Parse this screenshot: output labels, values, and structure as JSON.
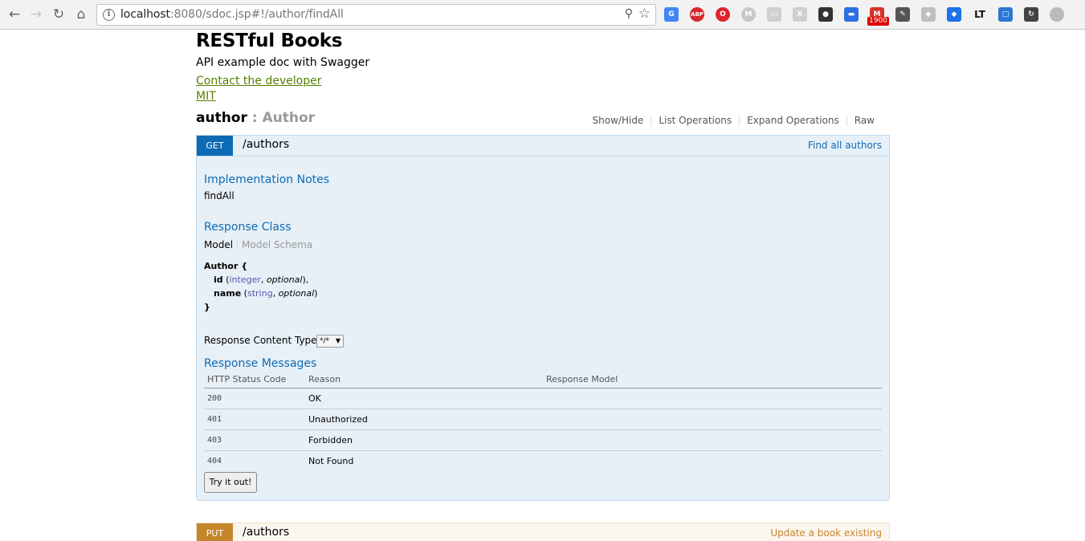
{
  "browser": {
    "url_host": "localhost",
    "url_rest": ":8080/sdoc.jsp#!/author/findAll",
    "extensions": [
      {
        "name": "translate-icon",
        "color": "#4285f4",
        "label": "G"
      },
      {
        "name": "adblock-icon",
        "color": "#d9262c",
        "label": "ABP"
      },
      {
        "name": "opera-icon",
        "color": "#e0242c",
        "label": "O"
      },
      {
        "name": "m-icon",
        "color": "#c8c8c8",
        "label": "M"
      },
      {
        "name": "save-icon",
        "color": "#cfcfcf",
        "label": "▭"
      },
      {
        "name": "x-icon",
        "color": "#cfcfcf",
        "label": "X"
      },
      {
        "name": "location-icon",
        "color": "#333333",
        "label": "●"
      },
      {
        "name": "calendar-icon",
        "color": "#2e6ee0",
        "label": "▬"
      },
      {
        "name": "gmail-icon",
        "color": "#d5332a",
        "label": "M"
      },
      {
        "name": "tag-icon",
        "color": "#555555",
        "label": "✎"
      },
      {
        "name": "dropbox-icon",
        "color": "#bfbfbf",
        "label": "◆"
      },
      {
        "name": "diamond-icon",
        "color": "#1a73e8",
        "label": "◆"
      },
      {
        "name": "lt-icon",
        "color": "#111111",
        "label": "LT"
      },
      {
        "name": "screen-icon",
        "color": "#2b77d6",
        "label": "□"
      },
      {
        "name": "sync-icon",
        "color": "#444444",
        "label": "↻"
      },
      {
        "name": "profile-icon",
        "color": "#bbbbbb",
        "label": " "
      }
    ],
    "gmail_badge": "1900"
  },
  "app": {
    "title": "RESTful Books",
    "description": "API example doc with Swagger",
    "contact_link": "Contact the developer",
    "license_link": "MIT"
  },
  "resource": {
    "name": "author",
    "separator_desc": " : Author",
    "actions": [
      "Show/Hide",
      "List Operations",
      "Expand Operations",
      "Raw"
    ]
  },
  "get_op": {
    "verb": "GET",
    "path": "/authors",
    "summary": "Find all authors",
    "impl_notes_title": "Implementation Notes",
    "impl_notes": "findAll",
    "response_class_title": "Response Class",
    "tab_model": "Model",
    "tab_schema": "Model Schema",
    "model": {
      "name": "Author {",
      "close": "}",
      "fields": [
        {
          "name": "id",
          "type": "integer",
          "opt": "optional",
          "tail": "),"
        },
        {
          "name": "name",
          "type": "string",
          "opt": "optional",
          "tail": ")"
        }
      ]
    },
    "content_type_label": "Response Content Type",
    "content_type_value": "*/*",
    "messages_title": "Response Messages",
    "table_headers": [
      "HTTP Status Code",
      "Reason",
      "Response Model"
    ],
    "messages": [
      {
        "code": "200",
        "reason": "OK",
        "model": ""
      },
      {
        "code": "401",
        "reason": "Unauthorized",
        "model": ""
      },
      {
        "code": "403",
        "reason": "Forbidden",
        "model": ""
      },
      {
        "code": "404",
        "reason": "Not Found",
        "model": ""
      }
    ],
    "try_button": "Try it out!"
  },
  "put_op": {
    "verb": "PUT",
    "path": "/authors",
    "summary": "Update a book existing"
  }
}
